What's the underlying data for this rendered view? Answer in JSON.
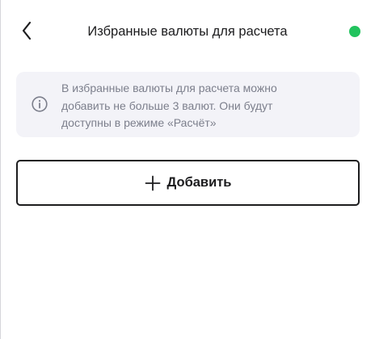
{
  "header": {
    "title": "Избранные валюты для расчета",
    "back_icon": "chevron-left-icon",
    "status_color": "#22c35e"
  },
  "info": {
    "icon": "info-circle-icon",
    "lines": [
      "В избранные валюты для расчета можно",
      "добавить не больше 3 валют. Они будут",
      "доступны в режиме «Расчёт»"
    ]
  },
  "add_button": {
    "icon": "plus-icon",
    "label": "Добавить"
  }
}
